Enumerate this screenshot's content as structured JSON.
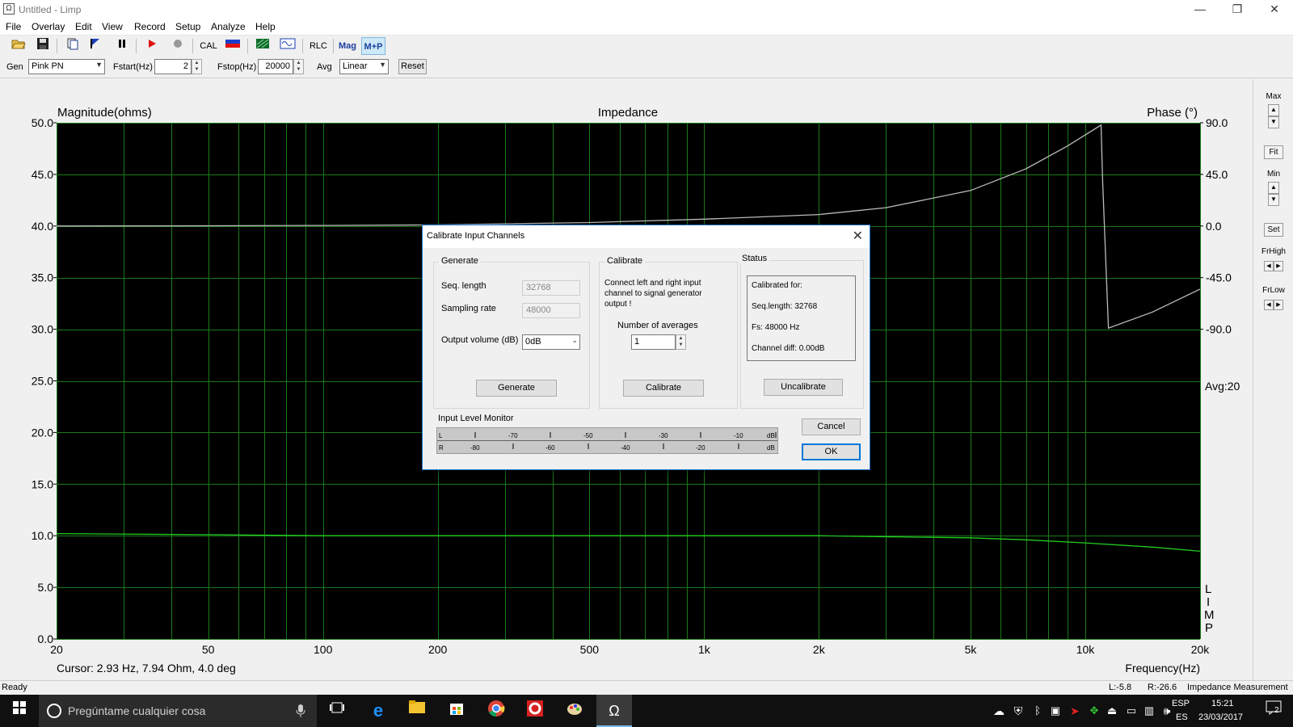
{
  "window": {
    "title": "Untitled - Limp",
    "app_icon": "Ω",
    "minimize": "—",
    "maximize": "❐",
    "close": "✕"
  },
  "menu": [
    "File",
    "Overlay",
    "Edit",
    "View",
    "Record",
    "Setup",
    "Analyze",
    "Help"
  ],
  "toolbar": {
    "cal_label": "CAL",
    "rlc_label": "RLC",
    "mag_label": "Mag",
    "mp_label": "M+P",
    "icons": [
      "open-icon",
      "save-icon",
      "copy-icon",
      "flag-icon",
      "pause-icon",
      "play-icon",
      "record-icon",
      "cal-icon",
      "color-icon",
      "grid-icon",
      "wave-icon"
    ]
  },
  "gen": {
    "gen_label": "Gen",
    "gen_value": "Pink PN",
    "fstart_label": "Fstart(Hz)",
    "fstart_value": "2",
    "fstop_label": "Fstop(Hz)",
    "fstop_value": "20000",
    "avg_label": "Avg",
    "avg_value": "Linear",
    "reset_label": "Reset"
  },
  "chart": {
    "left_title": "Magnitude(ohms)",
    "center_title": "Impedance",
    "right_title": "Phase (°)",
    "avg_label": "Avg:20",
    "limp_letters": [
      "L",
      "I",
      "M",
      "P"
    ],
    "cursor_text": "Cursor: 2.93 Hz, 7.94 Ohm, 4.0 deg",
    "xlabel": "Frequency(Hz)",
    "y_ticks": [
      "50.0",
      "45.0",
      "40.0",
      "35.0",
      "30.0",
      "25.0",
      "20.0",
      "15.0",
      "10.0",
      "5.0",
      "0.0"
    ],
    "phase_ticks": [
      "90.0",
      "45.0",
      "0.0",
      "-45.0",
      "-90.0"
    ],
    "x_ticks": [
      "20",
      "50",
      "100",
      "200",
      "500",
      "1k",
      "2k",
      "5k",
      "10k",
      "20k"
    ]
  },
  "chart_data": {
    "type": "line",
    "title": "Impedance",
    "xlabel": "Frequency(Hz)",
    "ylabel": "Magnitude(ohms)",
    "y2label": "Phase (°)",
    "xscale": "log",
    "xlim": [
      20,
      20000
    ],
    "ylim": [
      0,
      50
    ],
    "y2lim": [
      -90,
      90
    ],
    "grid": true,
    "series": [
      {
        "color": "#22cc22",
        "axis": "left",
        "x": [
          20,
          50,
          100,
          200,
          500,
          1000,
          2000,
          3000,
          5000,
          7000,
          10000,
          15000,
          20000
        ],
        "values": [
          10.2,
          10.1,
          10.0,
          10.0,
          10.0,
          10.0,
          10.0,
          9.9,
          9.8,
          9.6,
          9.3,
          8.9,
          8.5
        ]
      },
      {
        "color": "#bbbbbb",
        "axis": "right",
        "x": [
          20,
          50,
          100,
          200,
          500,
          1000,
          2000,
          3000,
          5000,
          7000,
          9000,
          11000,
          11100,
          11500,
          15000,
          20000
        ],
        "values": [
          0,
          0.2,
          0.5,
          1,
          3,
          6,
          10,
          16,
          31,
          50,
          70,
          88,
          40,
          -89,
          -75,
          -55
        ]
      }
    ]
  },
  "right_panel": {
    "max_label": "Max",
    "fit_label": "Fit",
    "min_label": "Min",
    "set_label": "Set",
    "frhigh_label": "FrHigh",
    "frlow_label": "FrLow"
  },
  "status": {
    "ready": "Ready",
    "l_value": "L:-5.8",
    "r_value": "R:-26.6",
    "mode": "Impedance Measurement"
  },
  "taskbar": {
    "search_placeholder": "Pregúntame cualquier cosa",
    "lang_top": "ESP",
    "lang_bottom": "ES",
    "time": "15:21",
    "date": "23/03/2017",
    "notifications": "2"
  },
  "dialog": {
    "title": "Calibrate Input Channels",
    "generate": {
      "group_title": "Generate",
      "seq_label": "Seq. length",
      "seq_value": "32768",
      "rate_label": "Sampling rate",
      "rate_value": "48000",
      "vol_label": "Output volume (dB)",
      "vol_value": "0dB",
      "button": "Generate"
    },
    "calibrate": {
      "group_title": "Calibrate",
      "instructions": "Connect left and right input channel  to  signal generator output !",
      "avg_label": "Number of averages",
      "avg_value": "1",
      "button": "Calibrate"
    },
    "status": {
      "group_title": "Status",
      "line1": "Calibrated for:",
      "line2": "Seq.length: 32768",
      "line3": "Fs: 48000 Hz",
      "line4": "Channel diff: 0.00dB",
      "button": "Uncalibrate"
    },
    "monitor": {
      "title": "Input Level Monitor",
      "top_ticks": [
        "L",
        "-70",
        "-50",
        "-30",
        "-10",
        "dB"
      ],
      "bottom_ticks": [
        "R",
        "-80",
        "-60",
        "-40",
        "-20",
        "dB"
      ]
    },
    "cancel": "Cancel",
    "ok": "OK"
  }
}
